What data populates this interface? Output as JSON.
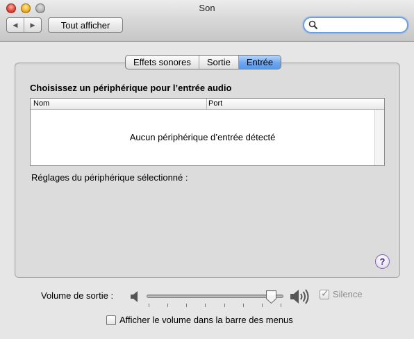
{
  "window": {
    "title": "Son"
  },
  "toolbar": {
    "back_glyph": "◀",
    "forward_glyph": "▶",
    "show_all_label": "Tout afficher",
    "search": {
      "value": "",
      "placeholder": ""
    }
  },
  "tabs": [
    {
      "label": "Effets sonores",
      "active": false
    },
    {
      "label": "Sortie",
      "active": false
    },
    {
      "label": "Entrée",
      "active": true
    }
  ],
  "input_panel": {
    "title": "Choisissez un périphérique pour l’entrée audio",
    "table": {
      "columns": [
        "Nom",
        "Port"
      ],
      "empty_message": "Aucun périphérique d’entrée détecté"
    },
    "settings_label": "Réglages du périphérique sélectionné :"
  },
  "help": {
    "glyph": "?"
  },
  "volume": {
    "label": "Volume de sortie :",
    "level": 0.95,
    "tick_count": 8
  },
  "silence": {
    "label": "Silence",
    "checked": true,
    "enabled": false,
    "mark": "✓"
  },
  "menubar_option": {
    "label": "Afficher le volume dans la barre des menus",
    "checked": false
  },
  "colors": {
    "accent": "#6ea6ef",
    "help": "#4b2a86"
  }
}
